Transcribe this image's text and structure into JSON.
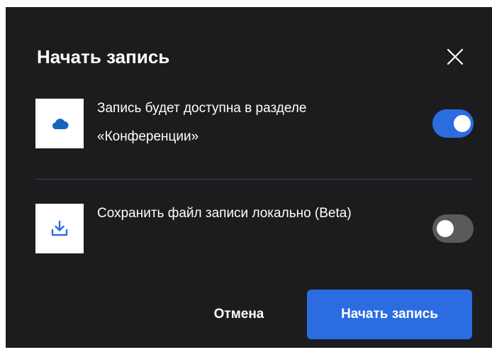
{
  "dialog": {
    "title": "Начать запись",
    "close_icon": "close-icon"
  },
  "options": [
    {
      "icon": "cloud-icon",
      "label": "Запись будет доступна в разделе «Конференции»",
      "enabled": true
    },
    {
      "icon": "download-icon",
      "label": "Сохранить файл записи локально (Beta)",
      "enabled": false
    }
  ],
  "buttons": {
    "cancel_label": "Отмена",
    "start_label": "Начать запись"
  },
  "colors": {
    "background": "#1c1c1e",
    "accent": "#2b6de0",
    "toggle_off": "#5a5a5c"
  }
}
